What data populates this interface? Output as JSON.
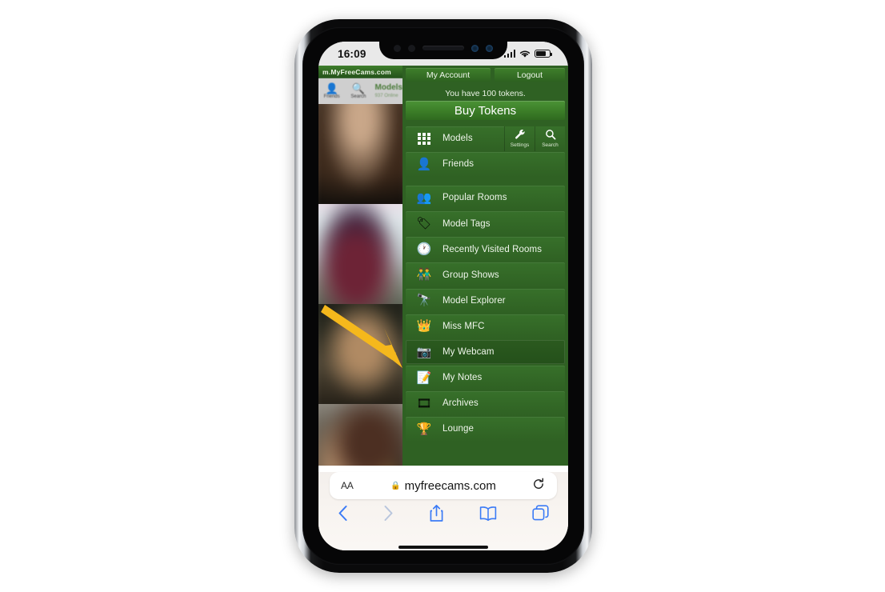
{
  "device": {
    "status_bar": {
      "time": "16:09",
      "signal_icon": "cellular-signal-icon",
      "wifi_icon": "wifi-icon",
      "battery_icon": "battery-icon"
    },
    "home_indicator": "home-indicator"
  },
  "webpage": {
    "site_logo": "m.MyFreeCams.com",
    "left_toolbar": {
      "friends": {
        "label": "Friends",
        "icon": "person-icon"
      },
      "search": {
        "label": "Search",
        "icon": "search-icon"
      },
      "models_title": "Models",
      "models_sub": "937 Online"
    },
    "account_bar": {
      "my_account": "My Account",
      "logout": "Logout"
    },
    "tokens": {
      "balance_text": "You have 100 tokens.",
      "buy_label": "Buy Tokens"
    },
    "toolbuttons": {
      "settings": {
        "label": "Settings",
        "icon": "wrench-icon"
      },
      "search": {
        "label": "Search",
        "icon": "search-icon"
      }
    },
    "menu_items": [
      {
        "label": "Models",
        "icon": "grid-icon",
        "glyph": "",
        "selected": false,
        "has_tools": true,
        "gap_after": false
      },
      {
        "label": "Friends",
        "icon": "person-bust-icon",
        "glyph": "👤",
        "selected": false,
        "has_tools": false,
        "gap_after": true
      },
      {
        "label": "Popular Rooms",
        "icon": "people-group-icon",
        "glyph": "👥",
        "selected": false,
        "has_tools": false,
        "gap_after": false
      },
      {
        "label": "Model Tags",
        "icon": "price-tag-icon",
        "glyph": "🏷",
        "selected": false,
        "has_tools": false,
        "gap_after": false
      },
      {
        "label": "Recently Visited Rooms",
        "icon": "clock-speech-icon",
        "glyph": "🕐",
        "selected": false,
        "has_tools": false,
        "gap_after": false
      },
      {
        "label": "Group Shows",
        "icon": "two-people-icon",
        "glyph": "👬",
        "selected": false,
        "has_tools": false,
        "gap_after": false
      },
      {
        "label": "Model Explorer",
        "icon": "binoculars-icon",
        "glyph": "🔭",
        "selected": false,
        "has_tools": false,
        "gap_after": false
      },
      {
        "label": "Miss MFC",
        "icon": "crown-icon",
        "glyph": "👑",
        "selected": false,
        "has_tools": false,
        "gap_after": false
      },
      {
        "label": "My Webcam",
        "icon": "webcam-icon",
        "glyph": "📷",
        "selected": true,
        "has_tools": false,
        "gap_after": false
      },
      {
        "label": "My Notes",
        "icon": "memo-icon",
        "glyph": "📝",
        "selected": false,
        "has_tools": false,
        "gap_after": false
      },
      {
        "label": "Archives",
        "icon": "film-reel-icon",
        "glyph": "🎞",
        "selected": false,
        "has_tools": false,
        "gap_after": false
      },
      {
        "label": "Lounge",
        "icon": "trophy-cup-icon",
        "glyph": "🏆",
        "selected": false,
        "has_tools": false,
        "gap_after": false
      }
    ]
  },
  "safari": {
    "text_size_label": "AA",
    "lock_icon": "lock-icon",
    "url": "myfreecams.com",
    "reload_icon": "reload-icon",
    "nav": {
      "back_icon": "chevron-left-icon",
      "forward_icon": "chevron-right-icon",
      "share_icon": "share-icon",
      "bookmarks_icon": "book-icon",
      "tabs_icon": "tabs-icon"
    }
  },
  "annotation": {
    "arrow_icon": "pointer-arrow-icon",
    "arrow_color": "#f5b81c",
    "points_to": "My Webcam"
  }
}
